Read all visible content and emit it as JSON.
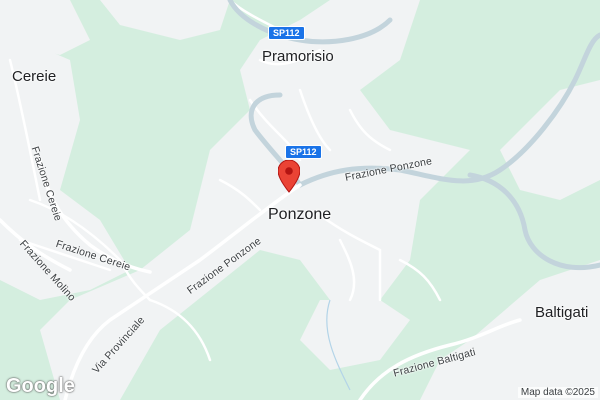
{
  "map": {
    "places": {
      "ponzone": "Ponzone",
      "pramorisio": "Pramorisio",
      "cereie": "Cereie",
      "baltigati": "Baltigati"
    },
    "roads": {
      "frazione_ponzone_east": "Frazione Ponzone",
      "frazione_ponzone_west": "Frazione Ponzone",
      "via_provinciale": "Via Provinciale",
      "frazione_cereie_vertical": "Frazione Cereie",
      "frazione_cereie": "Frazione Cereie",
      "frazione_molino": "Frazione Molino",
      "frazione_baltigati": "Frazione Baltigati"
    },
    "shields": {
      "sp112_top": "SP112",
      "sp112_center": "SP112"
    },
    "marker": {
      "icon": "map-pin-icon",
      "color": "#ea4335"
    },
    "colors": {
      "land": "#f1f3f4",
      "forest": "#d4eedf",
      "road": "#ffffff",
      "highway": "#c3d4dc"
    },
    "logo": "Google",
    "attribution": "Map data ©2025"
  }
}
